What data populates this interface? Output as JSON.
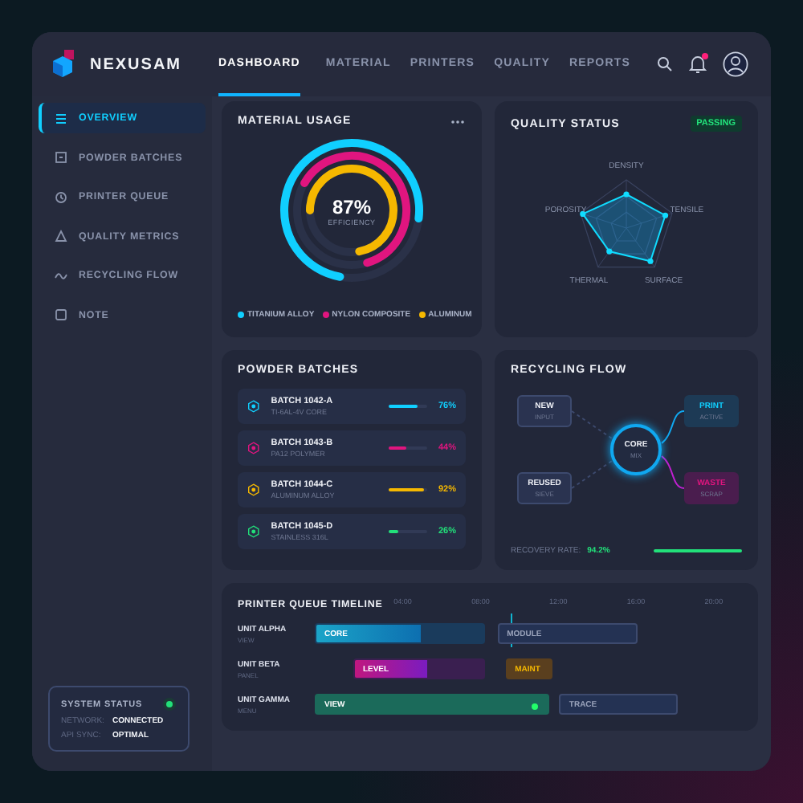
{
  "brand": "NEXUSAM",
  "nav": [
    {
      "label": "DASHBOARD",
      "selected": true
    },
    {
      "label": "MATERIAL",
      "selected": false
    },
    {
      "label": "PRINTERS",
      "selected": false
    },
    {
      "label": "QUALITY",
      "selected": false
    },
    {
      "label": "REPORTS",
      "selected": false
    }
  ],
  "notifications": {
    "unread": true
  },
  "sidebar": {
    "items": [
      {
        "label": "OVERVIEW",
        "kind": "list",
        "selected": true
      },
      {
        "label": "POWDER BATCHES",
        "kind": "box",
        "selected": false
      },
      {
        "label": "PRINTER QUEUE",
        "kind": "clock",
        "selected": false
      },
      {
        "label": "QUALITY METRICS",
        "kind": "triangle",
        "selected": false
      },
      {
        "label": "RECYCLING FLOW",
        "kind": "wave",
        "selected": false
      },
      {
        "label": "NOTE",
        "kind": "square",
        "selected": false
      }
    ],
    "system_status": {
      "title": "SYSTEM STATUS",
      "color": "#22e07a",
      "rows": [
        {
          "label": "NETWORK:",
          "value": "CONNECTED"
        },
        {
          "label": "API SYNC:",
          "value": "OPTIMAL"
        }
      ]
    }
  },
  "material_usage": {
    "title": "MATERIAL USAGE",
    "value": "87%",
    "caption": "EFFICIENCY",
    "materials": [
      {
        "name": "TITANIUM ALLOY",
        "color": "#10cfff"
      },
      {
        "name": "NYLON COMPOSITE",
        "color": "#e0157f"
      },
      {
        "name": "ALUMINUM",
        "color": "#f5b800"
      }
    ]
  },
  "quality_status": {
    "title": "QUALITY STATUS",
    "badge": "PASSING",
    "axes": [
      "DENSITY",
      "TENSILE",
      "SURFACE",
      "THERMAL",
      "POROSITY"
    ]
  },
  "powder_batches": {
    "title": "POWDER BATCHES",
    "batches": [
      {
        "name": "BATCH 1042-A",
        "material": "TI-6AL-4V CORE",
        "color": "#10cfff",
        "level": 0.76,
        "reading": "76%"
      },
      {
        "name": "BATCH 1043-B",
        "material": "PA12 POLYMER",
        "color": "#e0157f",
        "level": 0.44,
        "reading": "44%"
      },
      {
        "name": "BATCH 1044-C",
        "material": "ALUMINUM ALLOY",
        "color": "#f5b800",
        "level": 0.92,
        "reading": "92%"
      },
      {
        "name": "BATCH 1045-D",
        "material": "STAINLESS 316L",
        "color": "#22e07a",
        "level": 0.26,
        "reading": "26%"
      }
    ]
  },
  "recycling_flow": {
    "title": "RECYCLING FLOW",
    "nodes": [
      {
        "kind": "input",
        "title": "NEW",
        "subtitle": "INPUT"
      },
      {
        "kind": "input",
        "title": "REUSED",
        "subtitle": "SIEVE"
      },
      {
        "kind": "core",
        "title": "CORE",
        "subtitle": "MIX"
      },
      {
        "kind": "active",
        "title": "PRINT",
        "subtitle": "ACTIVE"
      },
      {
        "kind": "waste",
        "title": "WASTE",
        "subtitle": "SCRAP"
      }
    ],
    "recovery_label": "RECOVERY RATE:",
    "recovery_value": "94.2%"
  },
  "timeline": {
    "title": "PRINTER QUEUE TIMELINE",
    "ticks": [
      "04:00",
      "08:00",
      "12:00",
      "16:00",
      "20:00"
    ],
    "units": [
      {
        "name": "UNIT ALPHA",
        "sub": "VIEW",
        "tasks": [
          {
            "label": "CORE",
            "kind": "cyan",
            "level": 0.62
          },
          {
            "label": "MODULE",
            "kind": "plain"
          }
        ]
      },
      {
        "name": "UNIT BETA",
        "sub": "PANEL",
        "tasks": [
          {
            "label": "LEVEL",
            "kind": "magenta",
            "level": 0.56
          },
          {
            "label": "MAINT",
            "kind": "orange"
          }
        ]
      },
      {
        "name": "UNIT GAMMA",
        "sub": "MENU",
        "tasks": [
          {
            "label": "VIEW",
            "kind": "green",
            "live": true
          },
          {
            "label": "TRACE",
            "kind": "plain"
          }
        ]
      }
    ]
  }
}
